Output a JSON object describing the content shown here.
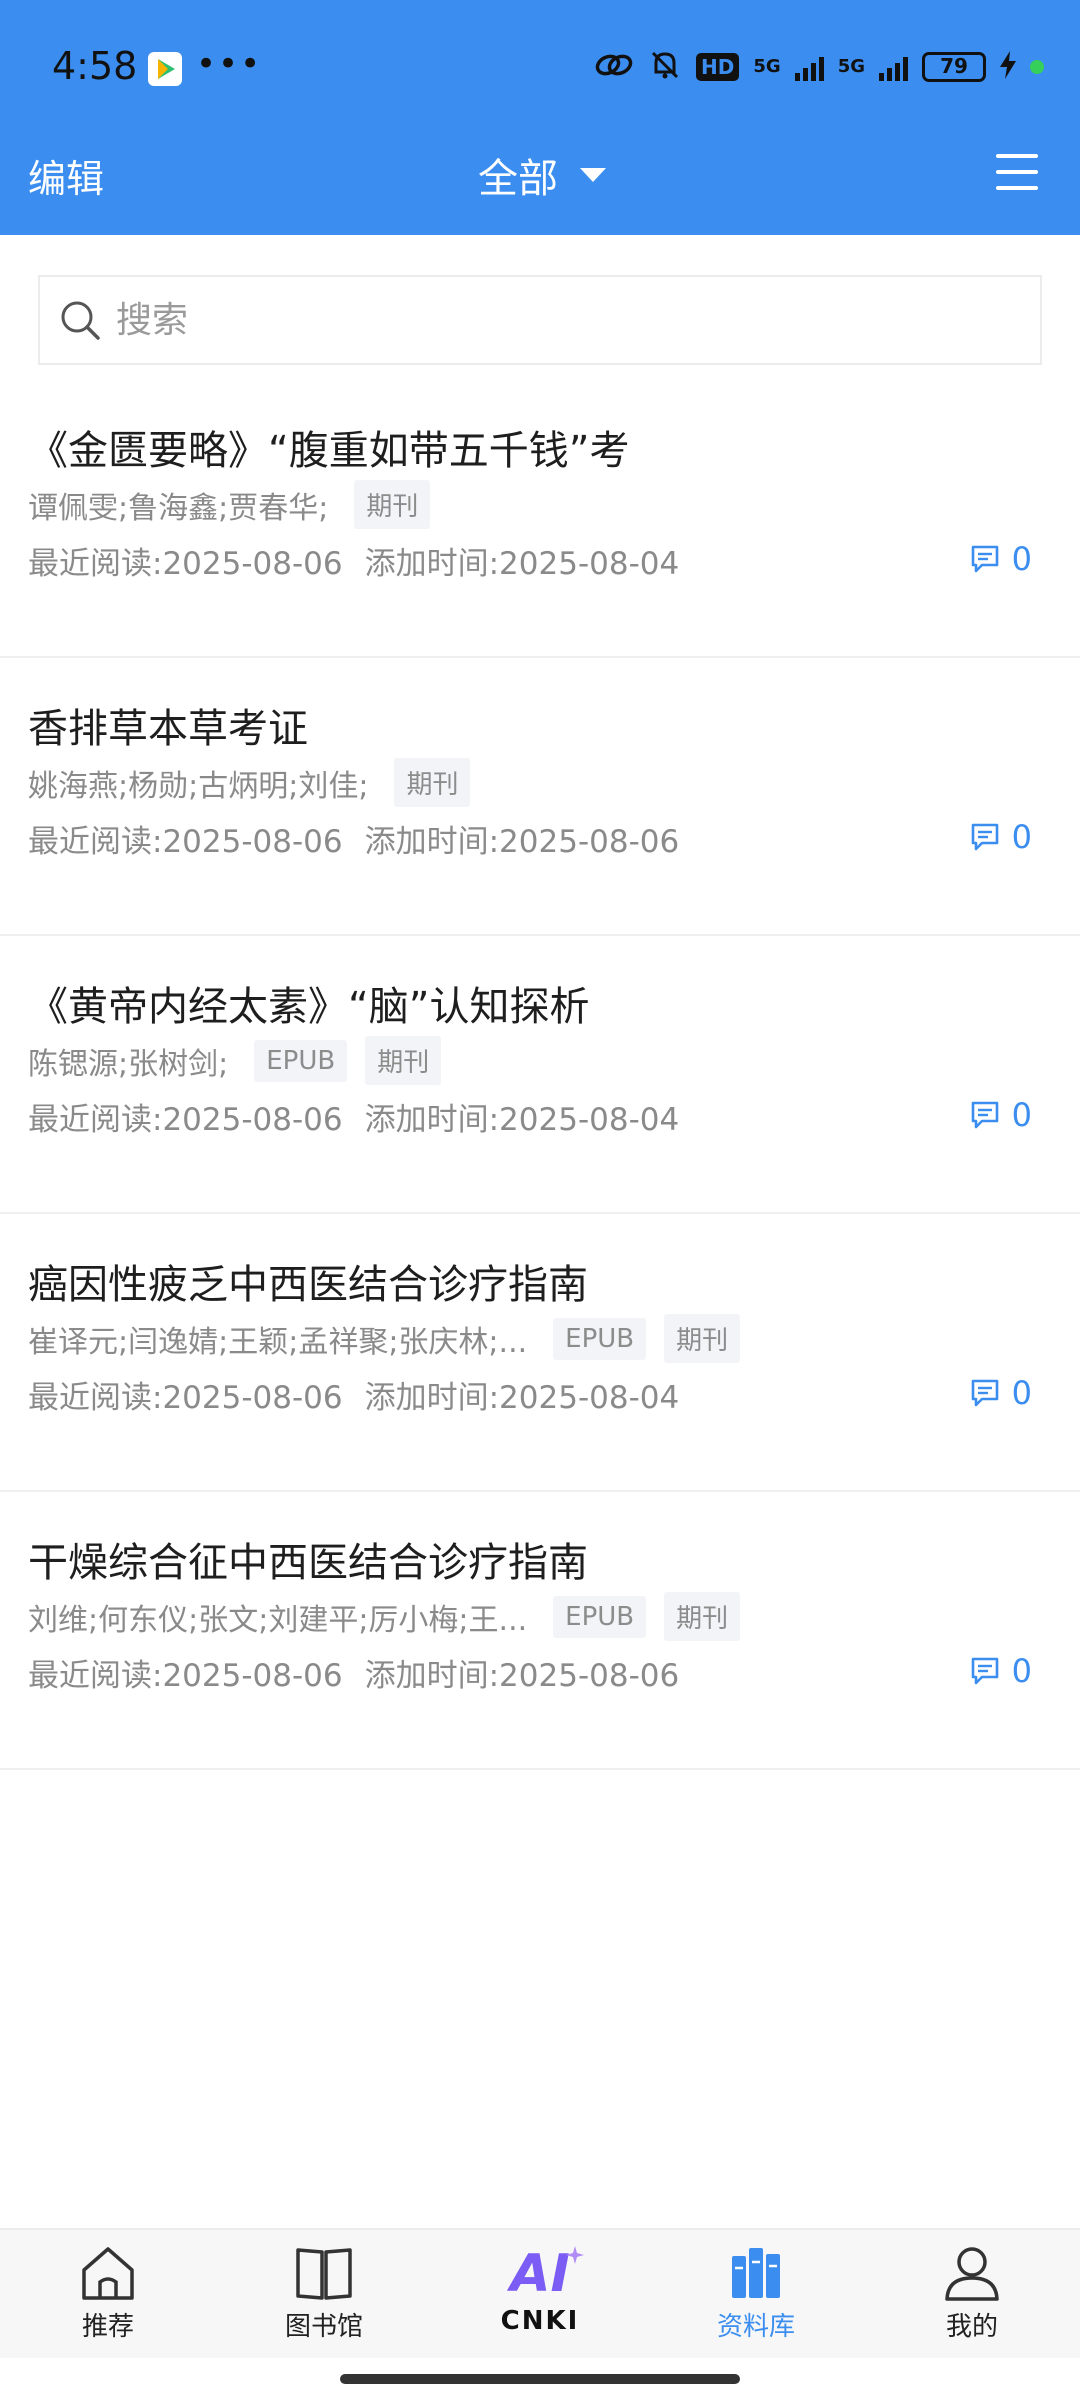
{
  "status_bar": {
    "time": "4:58",
    "network1": "5G",
    "network2": "5G",
    "hd_label": "HD",
    "battery": "79"
  },
  "header": {
    "edit_label": "编辑",
    "filter_label": "全部"
  },
  "search": {
    "placeholder": "搜索"
  },
  "items": [
    {
      "title": "《金匮要略》“腹重如带五千钱”考",
      "authors": "谭佩雯;鲁海鑫;贾春华;",
      "tags": [
        "期刊"
      ],
      "recent_read": "最近阅读:2025-08-06",
      "added": "添加时间:2025-08-04",
      "comments": "0"
    },
    {
      "title": "香排草本草考证",
      "authors": "姚海燕;杨勋;古炳明;刘佳;",
      "tags": [
        "期刊"
      ],
      "recent_read": "最近阅读:2025-08-06",
      "added": "添加时间:2025-08-06",
      "comments": "0"
    },
    {
      "title": "《黄帝内经太素》“脑”认知探析",
      "authors": "陈锶源;张树剑;",
      "tags": [
        "EPUB",
        "期刊"
      ],
      "recent_read": "最近阅读:2025-08-06",
      "added": "添加时间:2025-08-04",
      "comments": "0"
    },
    {
      "title": "癌因性疲乏中西医结合诊疗指南",
      "authors": "崔译元;闫逸婧;王颖;孟祥聚;张庆林;...",
      "tags": [
        "EPUB",
        "期刊"
      ],
      "recent_read": "最近阅读:2025-08-06",
      "added": "添加时间:2025-08-04",
      "comments": "0"
    },
    {
      "title": "干燥综合征中西医结合诊疗指南",
      "authors": "刘维;何东仪;张文;刘建平;厉小梅;王...",
      "tags": [
        "EPUB",
        "期刊"
      ],
      "recent_read": "最近阅读:2025-08-06",
      "added": "添加时间:2025-08-06",
      "comments": "0"
    }
  ],
  "nav": {
    "home": "推荐",
    "library": "图书馆",
    "cnki": "CNKI",
    "cnki_ai": "AI",
    "collection": "资料库",
    "me": "我的"
  },
  "colors": {
    "accent": "#3b8ef0",
    "ai_purple": "#7b5cf5"
  }
}
